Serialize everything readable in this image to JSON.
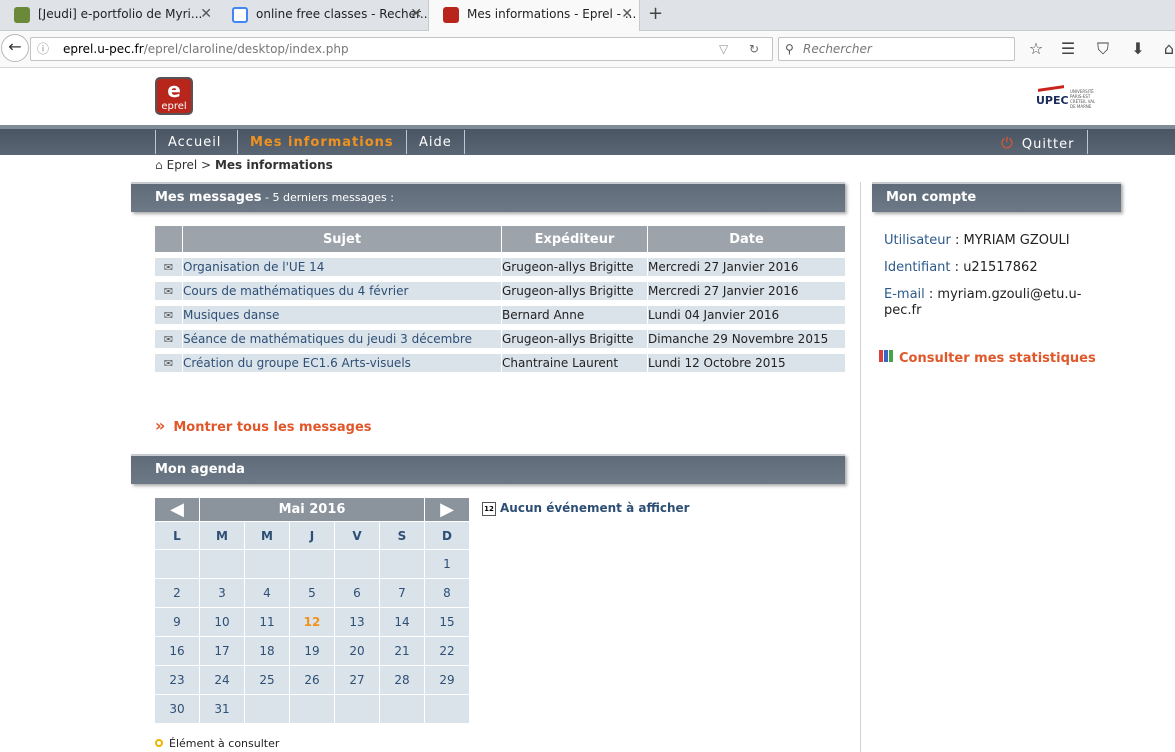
{
  "browser": {
    "tabs": [
      {
        "title": "[Jeudi] e-portfolio de Myri...",
        "close": "✕"
      },
      {
        "title": "online free classes - Recher...",
        "close": "✕"
      },
      {
        "title": "Mes informations - Eprel - ...",
        "close": "✕"
      }
    ],
    "new_tab": "+",
    "url_host": "eprel.u-pec.fr",
    "url_path": "/eprel/claroline/desktop/index.php",
    "search_placeholder": "Rechercher"
  },
  "header": {
    "logo_text": "eprel",
    "logo_letter": "e",
    "upec_text": "UPEC"
  },
  "menu": {
    "items": [
      "Accueil",
      "Mes informations",
      "Aide"
    ],
    "active": "Mes informations",
    "quit": "Quitter"
  },
  "breadcrumb": {
    "root": "Eprel",
    "sep": ">",
    "current": "Mes informations"
  },
  "messages": {
    "title": "Mes messages",
    "subtitle": " - 5 derniers messages :",
    "columns": [
      "Sujet",
      "Expéditeur",
      "Date"
    ],
    "rows": [
      {
        "subject": "Organisation de l'UE 14",
        "sender": "Grugeon-allys Brigitte",
        "date": "Mercredi 27 Janvier 2016"
      },
      {
        "subject": "Cours de mathématiques du 4 février",
        "sender": "Grugeon-allys Brigitte",
        "date": "Mercredi 27 Janvier 2016"
      },
      {
        "subject": "Musiques danse",
        "sender": "Bernard Anne",
        "date": "Lundi 04 Janvier 2016"
      },
      {
        "subject": "Séance de mathématiques du jeudi 3 décembre",
        "sender": "Grugeon-allys Brigitte",
        "date": "Dimanche 29 Novembre 2015"
      },
      {
        "subject": "Création du groupe EC1.6 Arts-visuels",
        "sender": "Chantraine Laurent",
        "date": "Lundi 12 Octobre 2015"
      }
    ],
    "show_all": "Montrer tous les messages"
  },
  "agenda": {
    "title": "Mon agenda",
    "month": "Mai 2016",
    "prev": "◀",
    "next": "▶",
    "weekdays": [
      "L",
      "M",
      "M",
      "J",
      "V",
      "S",
      "D"
    ],
    "weeks": [
      [
        "",
        "",
        "",
        "",
        "",
        "",
        "1"
      ],
      [
        "2",
        "3",
        "4",
        "5",
        "6",
        "7",
        "8"
      ],
      [
        "9",
        "10",
        "11",
        "12",
        "13",
        "14",
        "15"
      ],
      [
        "16",
        "17",
        "18",
        "19",
        "20",
        "21",
        "22"
      ],
      [
        "23",
        "24",
        "25",
        "26",
        "27",
        "28",
        "29"
      ],
      [
        "30",
        "31",
        "",
        "",
        "",
        "",
        ""
      ]
    ],
    "today": "12",
    "no_event": "Aucun événement à afficher",
    "calendar_icon_text": "12",
    "legend": "Élément à consulter"
  },
  "account": {
    "title": "Mon compte",
    "user_label": "Utilisateur",
    "user_value": "MYRIAM GZOULI",
    "id_label": "Identifiant",
    "id_value": "u21517862",
    "email_label": "E-mail",
    "email_value": "myriam.gzouli@etu.u-pec.fr",
    "stats_link": "Consulter mes statistiques"
  }
}
